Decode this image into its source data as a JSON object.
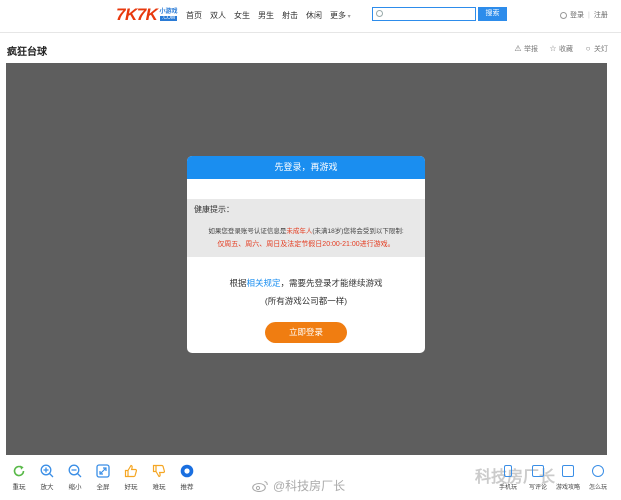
{
  "topbar": {
    "logo": "7K7K",
    "logo_sub": "小游戏",
    "logo_com": ".COM",
    "nav": [
      "首页",
      "双人",
      "女生",
      "男生",
      "射击",
      "休闲",
      "更多"
    ],
    "search_button": "搜索",
    "login": "登录",
    "register": "注册"
  },
  "game": {
    "title": "疯狂台球",
    "actions": [
      "举报",
      "收藏",
      "关灯"
    ]
  },
  "dialog": {
    "header": "先登录，再游戏",
    "health_title": "健康提示：",
    "health_line1_pre": "如果您登录账号认证信息是",
    "health_line1_red": "未成年人",
    "health_line1_post": "(未满18岁)您将会受到以下限制:",
    "health_line2": "仅周五、周六、周日及法定节假日20:00-21:00进行游戏。",
    "login_msg_pre": "根据",
    "login_msg_link": "相关规定",
    "login_msg_post": "，需要先登录才能继续游戏",
    "login_note": "(所有游戏公司都一样)",
    "login_button": "立即登录"
  },
  "toolbar": {
    "items": [
      {
        "label": "重玩",
        "icon": "refresh-icon",
        "color": "#58b948"
      },
      {
        "label": "放大",
        "icon": "zoom-in-icon",
        "color": "#3a8ee6"
      },
      {
        "label": "缩小",
        "icon": "zoom-out-icon",
        "color": "#3a8ee6"
      },
      {
        "label": "全屏",
        "icon": "fullscreen-icon",
        "color": "#3a8ee6"
      },
      {
        "label": "好玩",
        "icon": "thumbs-up-icon",
        "color": "#f5a623"
      },
      {
        "label": "难玩",
        "icon": "thumbs-down-icon",
        "color": "#f5a623"
      },
      {
        "label": "推荐",
        "icon": "recommend-icon",
        "color": "#1a6fe0"
      }
    ],
    "right_items": [
      "手机玩",
      "写评论",
      "游戏攻略",
      "怎么玩"
    ]
  },
  "watermark": "@科技房厂长",
  "watermark_right": "科技房厂长"
}
